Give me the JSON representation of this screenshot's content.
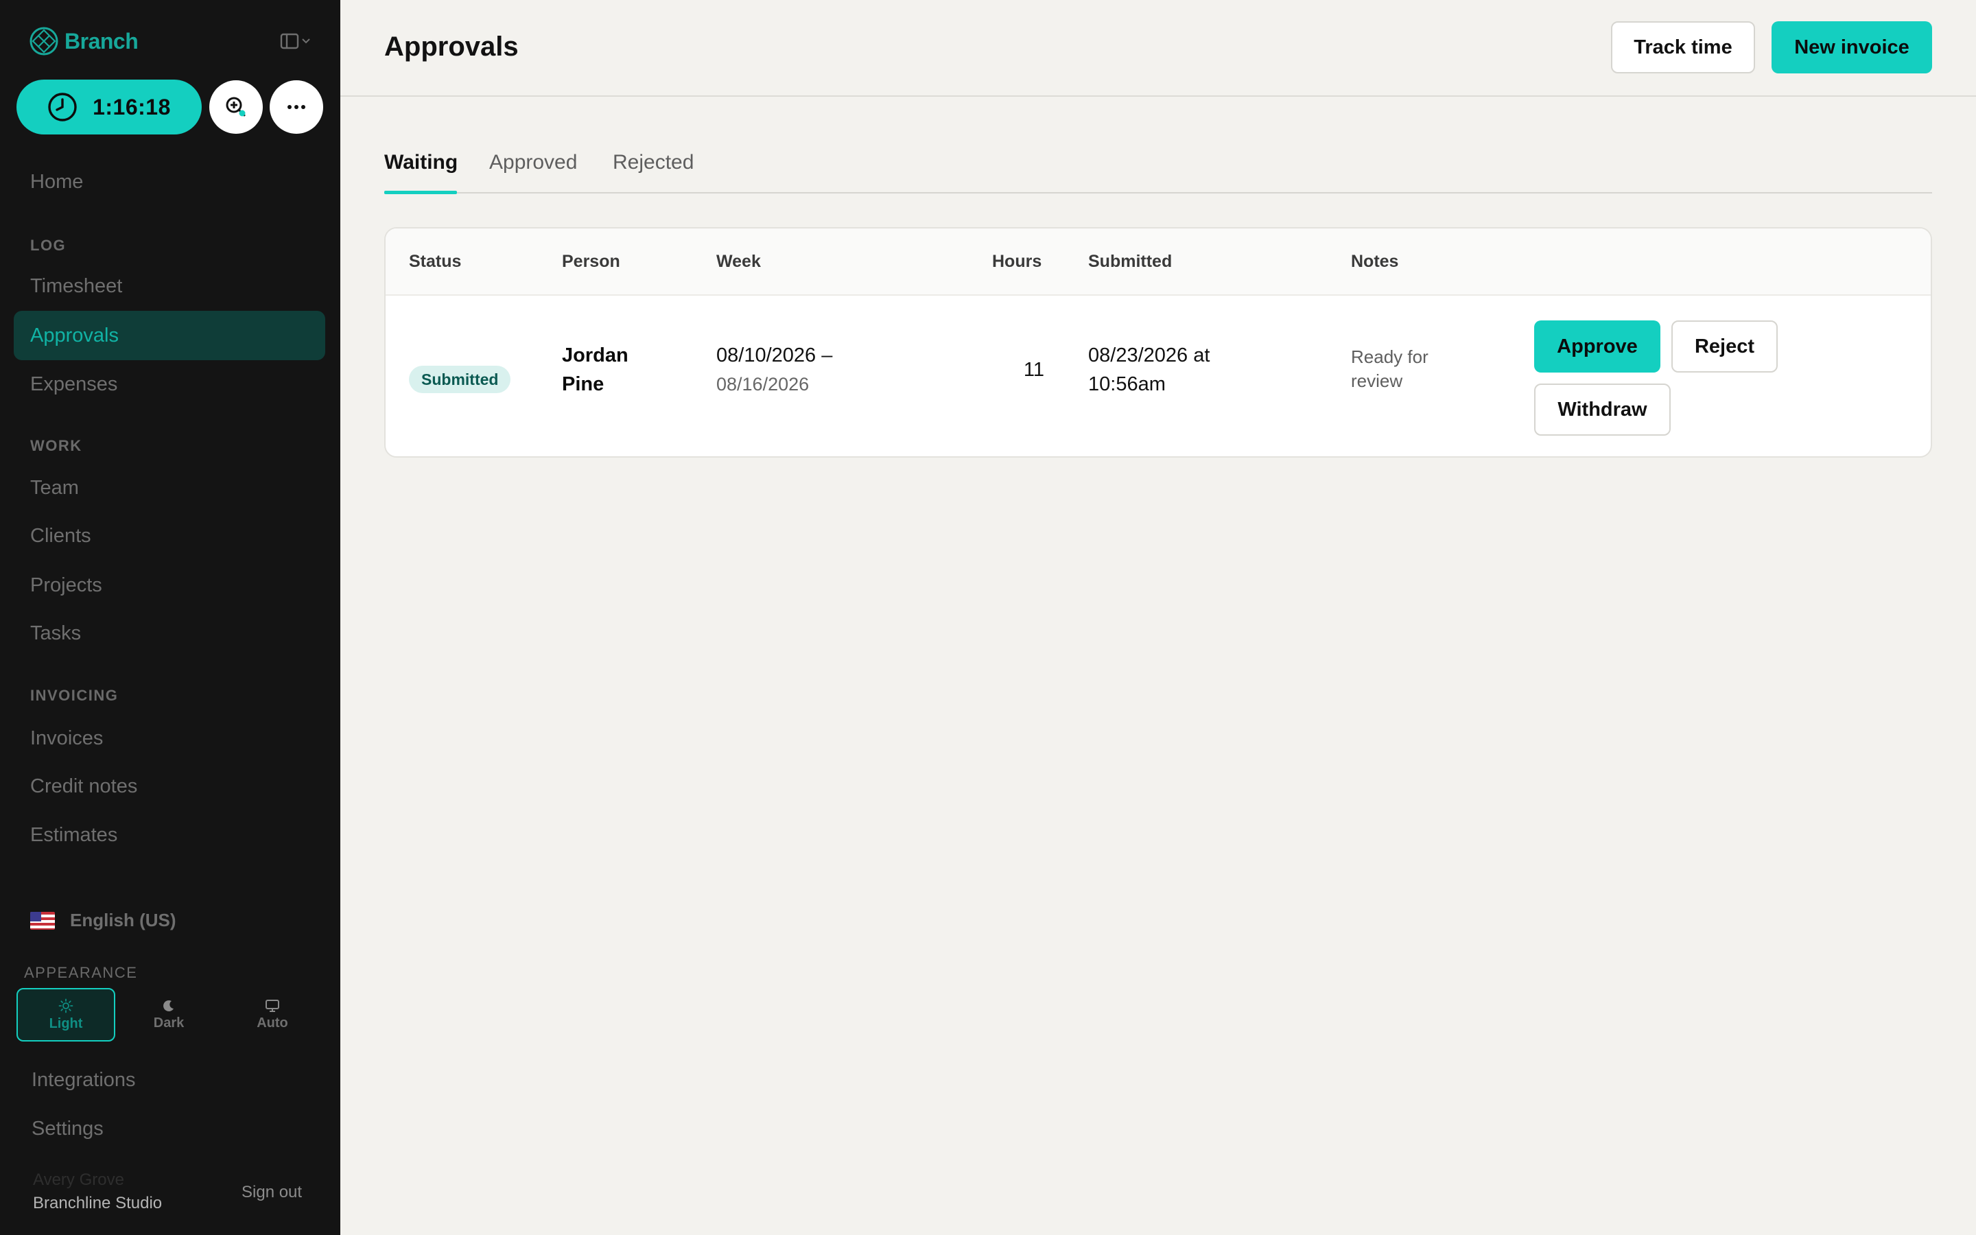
{
  "brand": {
    "name": "Branch"
  },
  "timer": {
    "value": "1:16:18"
  },
  "sidebar": {
    "home": "Home",
    "sections": [
      {
        "title": "LOG",
        "items": [
          "Timesheet",
          "Approvals",
          "Expenses"
        ]
      },
      {
        "title": "WORK",
        "items": [
          "Team",
          "Clients",
          "Projects",
          "Tasks"
        ]
      },
      {
        "title": "INVOICING",
        "items": [
          "Invoices",
          "Credit notes",
          "Estimates"
        ]
      }
    ],
    "active_item": "Approvals",
    "language": "English (US)",
    "appearance": {
      "label": "APPEARANCE",
      "options": [
        "Light",
        "Dark",
        "Auto"
      ],
      "selected": "Light"
    },
    "bottom_items": [
      "Integrations",
      "Settings"
    ],
    "user_name": "Avery Grove",
    "org_name": "Branchline Studio",
    "sign_out": "Sign out"
  },
  "header": {
    "title": "Approvals",
    "track_time": "Track time",
    "new_invoice": "New invoice"
  },
  "tabs": {
    "items": [
      "Waiting",
      "Approved",
      "Rejected"
    ],
    "active": "Waiting"
  },
  "table": {
    "columns": [
      "Status",
      "Person",
      "Week",
      "Hours",
      "Submitted",
      "Notes"
    ],
    "rows": [
      {
        "status": "Submitted",
        "person_first": "Jordan",
        "person_last": "Pine",
        "week_start": "08/10/2026 –",
        "week_end": "08/16/2026",
        "hours": "11",
        "submitted_line1": "08/23/2026 at",
        "submitted_line2": "10:56am",
        "notes_line1": "Ready for",
        "notes_line2": "review",
        "actions": {
          "approve": "Approve",
          "reject": "Reject",
          "withdraw": "Withdraw"
        }
      }
    ]
  },
  "colors": {
    "accent": "#14cfc0",
    "sidebar_bg": "#141414",
    "sidebar_active_bg": "#0f3d38",
    "page_bg": "#f3f2ee"
  }
}
